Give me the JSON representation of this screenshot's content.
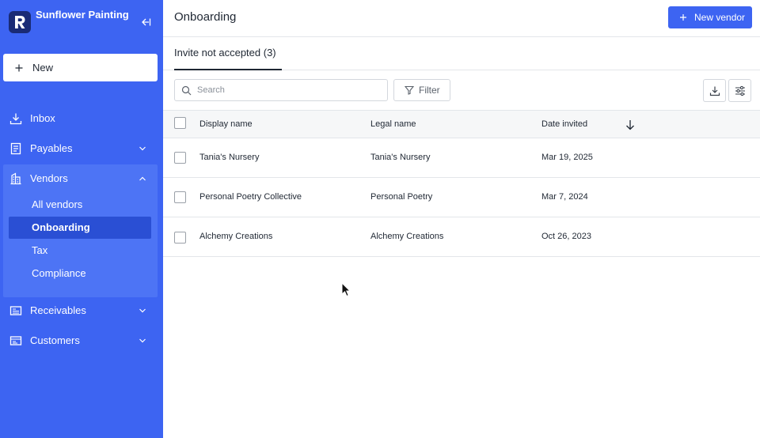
{
  "brand": {
    "name": "Sunflower Painting",
    "logo_letter": "R"
  },
  "sidebar": {
    "new_label": "New",
    "items": [
      {
        "label": "Inbox",
        "icon": "inbox-icon"
      },
      {
        "label": "Payables",
        "icon": "payables-icon"
      },
      {
        "label": "Vendors",
        "icon": "vendors-icon"
      },
      {
        "label": "Receivables",
        "icon": "receivables-icon"
      },
      {
        "label": "Customers",
        "icon": "customers-icon"
      }
    ],
    "vendor_subitems": [
      {
        "label": "All vendors"
      },
      {
        "label": "Onboarding",
        "active": true
      },
      {
        "label": "Tax"
      },
      {
        "label": "Compliance"
      }
    ]
  },
  "main": {
    "title": "Onboarding",
    "new_vendor_label": "New vendor",
    "tabs": [
      {
        "label": "Invite not accepted (3)",
        "active": true
      }
    ],
    "search": {
      "placeholder": "Search",
      "value": ""
    },
    "filter_label": "Filter",
    "table": {
      "columns": [
        "Display name",
        "Legal name",
        "Date invited"
      ],
      "sort": {
        "column": "Date invited",
        "direction": "descending"
      },
      "rows": [
        {
          "display_name": "Tania's Nursery",
          "legal_name": "Tania's Nursery",
          "date_invited": "Mar 19, 2025"
        },
        {
          "display_name": "Personal Poetry Collective",
          "legal_name": "Personal Poetry",
          "date_invited": "Mar 7, 2024"
        },
        {
          "display_name": "Alchemy Creations",
          "legal_name": "Alchemy Creations",
          "date_invited": "Oct 26, 2023"
        }
      ]
    }
  },
  "colors": {
    "sidebar": "#3d64f2",
    "sidebar_group": "#4d74f5",
    "sidebar_active": "#2a4fd4",
    "logo_bg": "#1a2b75",
    "primary_button": "#3d64f2"
  }
}
